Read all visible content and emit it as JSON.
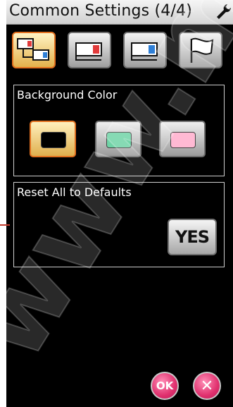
{
  "title": "Common Settings (4/4)",
  "tabs": [
    {
      "icon": "two-machines-icon",
      "active": true
    },
    {
      "icon": "machine-red-icon",
      "active": false
    },
    {
      "icon": "machine-blue-icon",
      "active": false
    },
    {
      "icon": "flag-icon",
      "active": false
    }
  ],
  "background_color": {
    "label": "Background Color",
    "options": [
      {
        "color": "#000000",
        "selected": true
      },
      {
        "color": "#6fd3a6",
        "selected": false
      },
      {
        "color": "#ffb9d3",
        "selected": false
      }
    ]
  },
  "reset": {
    "label": "Reset All to Defaults",
    "button_label": "YES"
  },
  "footer": {
    "ok_label": "OK",
    "close_label": "✕"
  },
  "watermark_text": "www.ma"
}
